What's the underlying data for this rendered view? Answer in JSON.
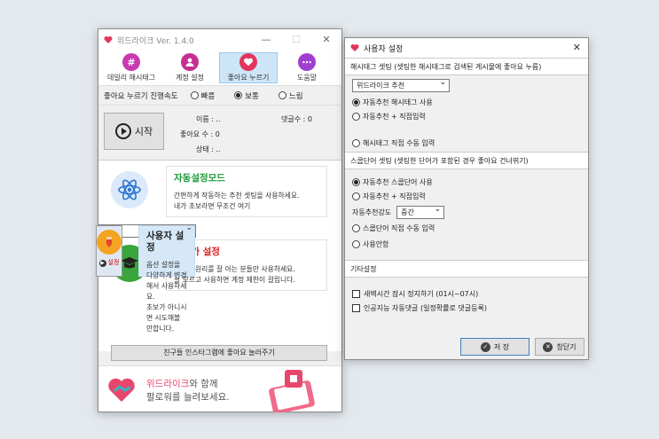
{
  "main": {
    "title": "위드라이크 Ver. 1.4.0",
    "toolbar": [
      {
        "label": "데일리 해시태그",
        "icon": "hashtag-icon",
        "color": "#c83bb0"
      },
      {
        "label": "계정 설정",
        "icon": "user-icon",
        "color": "#c62f8f"
      },
      {
        "label": "좋아요 누르기",
        "icon": "heart-icon",
        "color": "#e2365e"
      },
      {
        "label": "도움말",
        "icon": "chat-icon",
        "color": "#a03fd2"
      }
    ],
    "speed": {
      "label": "좋아요 누르기 진행속도",
      "options": [
        "빠름",
        "보통",
        "느림"
      ],
      "selected": "보통"
    },
    "start_label": "시작",
    "stats": {
      "name_label": "이름 :",
      "name_value": "..",
      "comments_label": "댓글수 :",
      "comments_value": "0",
      "likes_label": "좋아요 수 :",
      "likes_value": "0",
      "state_label": "상태 :",
      "state_value": ".."
    },
    "modes": [
      {
        "title": "자동설정모드",
        "title_color": "#1e9a3a",
        "desc1": "간편하게 작동하는 추천 셋팅을 사용하세요.",
        "desc2": "내가 초보라면 무조건 여기"
      },
      {
        "title": "사용자 설정",
        "title_color": "#222222",
        "desc1": "옵션 설정을 다양하게 변경해서 사용하세요.",
        "desc2": "초보가 아니시면 시도해볼 만합니다.",
        "setting_label": "설정"
      },
      {
        "title": "전문가 설정",
        "title_color": "#e02020",
        "desc1": "인스타 원리를 잘 아는 분들만 사용하세요.",
        "desc2": "잘 모르고 사용하면 계정 제한이 걸립니다."
      }
    ],
    "friend_button": "친구들 인스타그램에 좋아요 눌러주기",
    "banner": {
      "brand": "위드라이크",
      "line1_suffix": "와 함께",
      "line2": "팔로워를 늘려보세요."
    }
  },
  "settings": {
    "title": "사용자 설정",
    "hashtag": {
      "header": "해시태그 셋팅 (셋팅한 해시태그로 검색된 게시물에 좋아요 누름)",
      "dropdown": "위드라이크 추천",
      "options": [
        "자동추천 해시태그 사용",
        "자동추천 + 직접입력",
        "해시태그 직접 수동 입력"
      ],
      "selected": 0
    },
    "stopword": {
      "header": "스쿱단어 셋팅 (셋팅한 단어가 포함된 경우 좋아요 건너뛰기)",
      "options": [
        "자동추천 스쿱단어 사용",
        "자동추천 + 직접입력"
      ],
      "strength_label": "자동추천강도",
      "strength_value": "중간",
      "options2": [
        "스쿱단어 직접 수동 입력",
        "사용안함"
      ],
      "selected": 0
    },
    "other": {
      "header": "기타설정",
      "checks": [
        "새벽시간 잠시 정지하기 (01시~07시)",
        "인공지능 자동댓글 (일정확률로 댓글등록)"
      ]
    },
    "save_label": "저 장",
    "close_label": "창닫기"
  }
}
